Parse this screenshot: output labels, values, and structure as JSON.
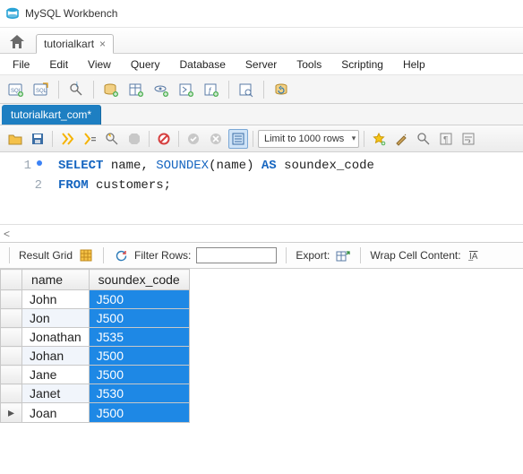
{
  "app": {
    "title": "MySQL Workbench"
  },
  "navtab": {
    "label": "tutorialkart"
  },
  "menu": {
    "file": "File",
    "edit": "Edit",
    "view": "View",
    "query": "Query",
    "database": "Database",
    "server": "Server",
    "tools": "Tools",
    "scripting": "Scripting",
    "help": "Help"
  },
  "editor_tab": {
    "label": "tutorialkart_com*"
  },
  "limit": {
    "label": "Limit to 1000 rows"
  },
  "sql": {
    "l1_select": "SELECT",
    "l1_name": " name",
    "l1_comma": ", ",
    "l1_fn": "SOUNDEX",
    "l1_open": "(",
    "l1_arg": "name",
    "l1_close": ") ",
    "l1_as": "AS",
    "l1_alias": " soundex_code",
    "l2_from": "FROM",
    "l2_tbl": " customers",
    "l2_semi": ";",
    "line1_text": "SELECT name, SOUNDEX(name) AS soundex_code",
    "line2_text": "FROM customers;"
  },
  "gutter": {
    "l1": "1",
    "l2": "2"
  },
  "hscroll": {
    "marker": "<"
  },
  "result_toolbar": {
    "result_grid": "Result Grid",
    "filter_rows": "Filter Rows:",
    "export": "Export:",
    "wrap": "Wrap Cell Content:"
  },
  "columns": {
    "c1": "name",
    "c2": "soundex_code"
  },
  "rows": [
    {
      "name": "John",
      "code": "J500"
    },
    {
      "name": "Jon",
      "code": "J500"
    },
    {
      "name": "Jonathan",
      "code": "J535"
    },
    {
      "name": "Johan",
      "code": "J500"
    },
    {
      "name": "Jane",
      "code": "J500"
    },
    {
      "name": "Janet",
      "code": "J530"
    },
    {
      "name": "Joan",
      "code": "J500"
    }
  ],
  "active_row_marker": "▸",
  "chart_data": {
    "type": "table",
    "columns": [
      "name",
      "soundex_code"
    ],
    "data": [
      [
        "John",
        "J500"
      ],
      [
        "Jon",
        "J500"
      ],
      [
        "Jonathan",
        "J535"
      ],
      [
        "Johan",
        "J500"
      ],
      [
        "Jane",
        "J500"
      ],
      [
        "Janet",
        "J530"
      ],
      [
        "Joan",
        "J500"
      ]
    ]
  },
  "colors": {
    "accent": "#1e7fc2",
    "selection": "#1e88e5"
  }
}
